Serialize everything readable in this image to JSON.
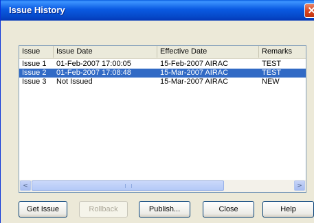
{
  "window": {
    "title": "Issue History",
    "close_glyph": "✕"
  },
  "columns": [
    "Issue",
    "Issue Date",
    "Effective Date",
    "Remarks"
  ],
  "rows": [
    {
      "issue": "Issue 1",
      "issue_date": "01-Feb-2007 17:00:05",
      "effective_date": "15-Feb-2007 AIRAC",
      "remarks": "TEST",
      "selected": false
    },
    {
      "issue": "Issue 2",
      "issue_date": "01-Feb-2007 17:08:48",
      "effective_date": "15-Mar-2007 AIRAC",
      "remarks": "TEST",
      "selected": true
    },
    {
      "issue": "Issue 3",
      "issue_date": "Not Issued",
      "effective_date": "15-Mar-2007 AIRAC",
      "remarks": "NEW",
      "selected": false
    }
  ],
  "scrollbar": {
    "left_arrow": "<",
    "right_arrow": ">"
  },
  "buttons": {
    "get_issue": "Get Issue",
    "rollback": "Rollback",
    "publish": "Publish...",
    "close": "Close",
    "help": "Help"
  },
  "colors": {
    "selection": "#316ac5",
    "titlebar": "#0a5ae2"
  }
}
